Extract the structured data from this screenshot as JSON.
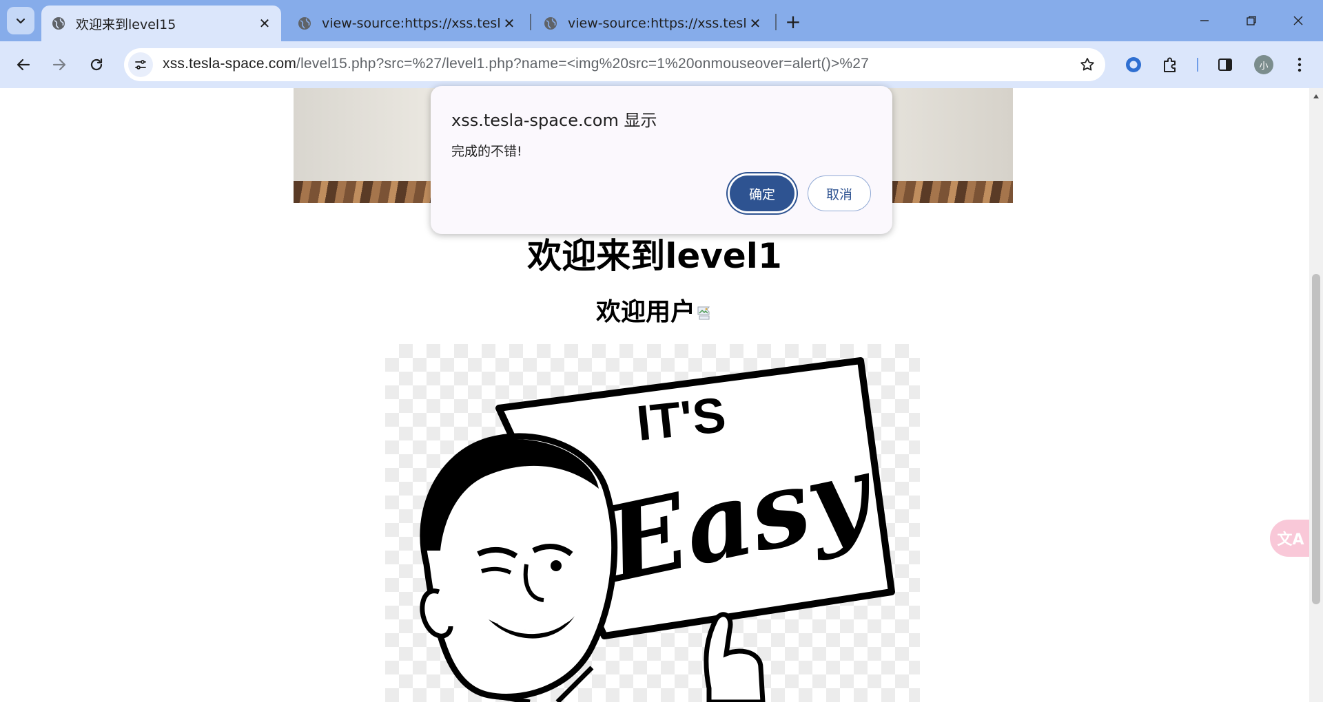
{
  "browser": {
    "tabs": [
      {
        "title": "欢迎来到level15",
        "active": true
      },
      {
        "title": "view-source:https://xss.tesla-",
        "active": false
      },
      {
        "title": "view-source:https://xss.tesla-",
        "active": false
      }
    ],
    "address": {
      "host": "xss.tesla-space.com",
      "path": "/level15.php?src=%27/level1.php?name=<img%20src=1%20onmouseover=alert()>%27"
    },
    "profile_initial": "小",
    "icons": [
      "tab-search-icon",
      "globe-icon",
      "close-icon",
      "plus-icon",
      "minimize-icon",
      "restore-icon",
      "back-icon",
      "forward-icon",
      "reload-icon",
      "tune-icon",
      "star-icon",
      "extension-circle-icon",
      "puzzle-icon",
      "sidepanel-icon",
      "menu-icon"
    ]
  },
  "page": {
    "heading": "欢迎来到level1",
    "user_text": "欢迎用户",
    "image_text": [
      "IT'S",
      "Easy"
    ]
  },
  "dialog": {
    "title": "xss.tesla-space.com 显示",
    "message": "完成的不错!",
    "ok_label": "确定",
    "cancel_label": "取消"
  },
  "translate_widget": {
    "label": "文A"
  },
  "colors": {
    "tabstrip": "#86acea",
    "toolbar": "#dbe6fb",
    "dialog_ok": "#2e5391",
    "dialog_bg": "#fbf8fd"
  }
}
